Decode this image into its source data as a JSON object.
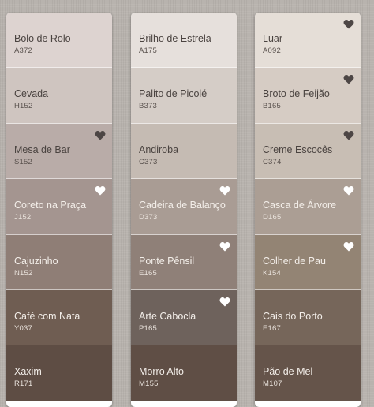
{
  "columns": [
    {
      "chips": [
        {
          "name": "Bolo de Rolo",
          "code": "A372",
          "color": "#ddd3d0",
          "text": "dark",
          "heart": null
        },
        {
          "name": "Cevada",
          "code": "H152",
          "color": "#cfc5c0",
          "text": "dark",
          "heart": null
        },
        {
          "name": "Mesa de Bar",
          "code": "S152",
          "color": "#b9aca8",
          "text": "dark",
          "heart": "dark"
        },
        {
          "name": "Coreto na Praça",
          "code": "J152",
          "color": "#a49590",
          "text": "light",
          "heart": "white"
        },
        {
          "name": "Cajuzinho",
          "code": "N152",
          "color": "#8f7e76",
          "text": "light",
          "heart": null
        },
        {
          "name": "Café com Nata",
          "code": "Y037",
          "color": "#6f5d52",
          "text": "light",
          "heart": null
        },
        {
          "name": "Xaxim",
          "code": "R171",
          "color": "#5e4d44",
          "text": "light",
          "heart": null
        }
      ]
    },
    {
      "chips": [
        {
          "name": "Brilho de Estrela",
          "code": "A175",
          "color": "#e6e0dc",
          "text": "dark",
          "heart": null
        },
        {
          "name": "Palito de Picolé",
          "code": "B373",
          "color": "#d5cdc7",
          "text": "dark",
          "heart": null
        },
        {
          "name": "Andiroba",
          "code": "C373",
          "color": "#c5bbb3",
          "text": "dark",
          "heart": null
        },
        {
          "name": "Cadeira de Balanço",
          "code": "D373",
          "color": "#a99c94",
          "text": "light",
          "heart": "white"
        },
        {
          "name": "Ponte Pênsil",
          "code": "E165",
          "color": "#8f8078",
          "text": "light",
          "heart": "white"
        },
        {
          "name": "Arte Cabocla",
          "code": "P165",
          "color": "#6e625c",
          "text": "light",
          "heart": "white"
        },
        {
          "name": "Morro Alto",
          "code": "M155",
          "color": "#5f4e45",
          "text": "light",
          "heart": null
        }
      ]
    },
    {
      "chips": [
        {
          "name": "Luar",
          "code": "A092",
          "color": "#e5ded7",
          "text": "dark",
          "heart": "dark"
        },
        {
          "name": "Broto de Feijão",
          "code": "B165",
          "color": "#d6ccc4",
          "text": "dark",
          "heart": "dark"
        },
        {
          "name": "Creme Escocês",
          "code": "C374",
          "color": "#c8beb4",
          "text": "dark",
          "heart": "dark"
        },
        {
          "name": "Casca de Árvore",
          "code": "D165",
          "color": "#ab9e94",
          "text": "light",
          "heart": "white"
        },
        {
          "name": "Colher de Pau",
          "code": "K154",
          "color": "#938474",
          "text": "light",
          "heart": "white"
        },
        {
          "name": "Cais do Porto",
          "code": "E167",
          "color": "#76665a",
          "text": "light",
          "heart": null
        },
        {
          "name": "Pão de Mel",
          "code": "M107",
          "color": "#65544a",
          "text": "light",
          "heart": null
        }
      ]
    }
  ],
  "heart_colors": {
    "dark": "#4d4645",
    "white": "#ffffff"
  }
}
